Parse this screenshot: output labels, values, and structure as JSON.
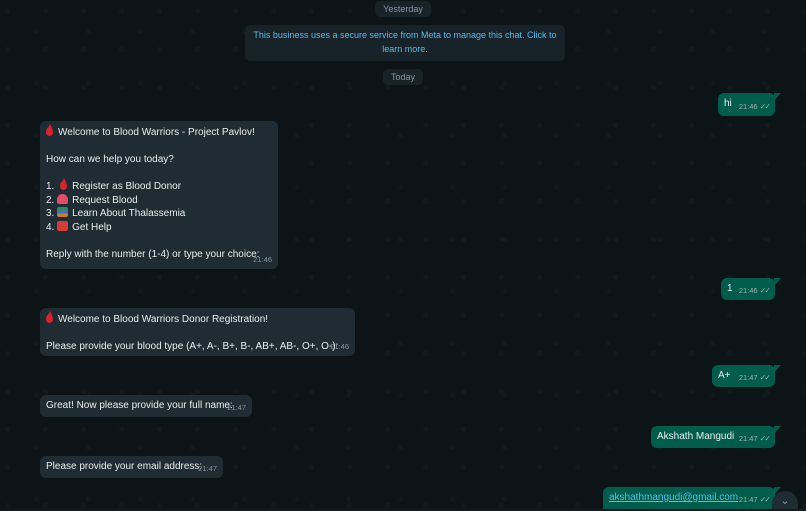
{
  "dates": {
    "yesterday": "Yesterday",
    "today": "Today"
  },
  "notice": "This business uses a secure service from Meta to manage this chat. Click to learn more.",
  "messages": {
    "m1": {
      "text": "hi",
      "time": "21:46"
    },
    "m2": {
      "title": "Welcome to Blood Warriors - Project Pavlov!",
      "prompt": "How can we help you today?",
      "options": [
        {
          "num": "1.",
          "label": "Register as Blood Donor",
          "icon": "drop-icon"
        },
        {
          "num": "2.",
          "label": "Request Blood",
          "icon": "siren-icon"
        },
        {
          "num": "3.",
          "label": "Learn About Thalassemia",
          "icon": "books-icon"
        },
        {
          "num": "4.",
          "label": "Get Help",
          "icon": "sos-icon"
        }
      ],
      "footer": "Reply with the number (1-4) or type your choice:",
      "time": "21:46"
    },
    "m3": {
      "text": "1",
      "time": "21:46"
    },
    "m4": {
      "title": "Welcome to Blood Warriors Donor Registration!",
      "body": "Please provide your blood type (A+, A-, B+, B-, AB+, AB-, O+, O-):",
      "time": "21:46"
    },
    "m5": {
      "text": "A+",
      "time": "21:47"
    },
    "m6": {
      "text": "Great! Now please provide your full name:",
      "time": "21:47"
    },
    "m7": {
      "text": "Akshath Mangudi",
      "time": "21:47"
    },
    "m8": {
      "text": "Please provide your email address:",
      "time": "21:47"
    },
    "m9": {
      "text": "akshathmangudi@gmail.com",
      "time": "21:47"
    }
  },
  "colors": {
    "background": "#0d1418",
    "incoming": "#202c33",
    "outgoing": "#005c4b",
    "link": "#53bdeb",
    "blood": "#d8232a"
  }
}
